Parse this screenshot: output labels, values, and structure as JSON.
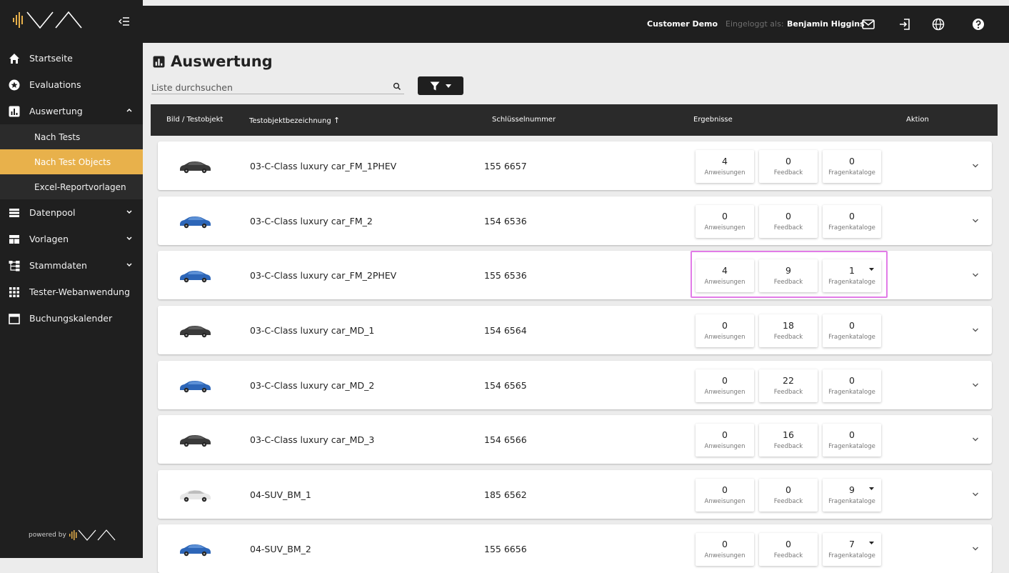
{
  "sidebar": {
    "items": [
      {
        "label": "Startseite",
        "icon": "home-icon"
      },
      {
        "label": "Evaluations",
        "icon": "star-badge-icon"
      },
      {
        "label": "Auswertung",
        "icon": "chart-icon"
      }
    ],
    "subitems": [
      {
        "label": "Nach Tests"
      },
      {
        "label": "Nach Test Objects"
      },
      {
        "label": "Excel-Reportvorlagen"
      }
    ],
    "items2": [
      {
        "label": "Datenpool",
        "icon": "list-icon"
      },
      {
        "label": "Vorlagen",
        "icon": "template-icon"
      },
      {
        "label": "Stammdaten",
        "icon": "hierarchy-icon"
      },
      {
        "label": "Tester-Webanwendung",
        "icon": "grid-icon"
      },
      {
        "label": "Buchungskalender",
        "icon": "calendar-icon"
      }
    ],
    "powered_by": "powered by"
  },
  "topbar": {
    "customer": "Customer Demo",
    "logged_in_label": "Eingeloggt als:",
    "user_name": "Benjamin Higgins"
  },
  "main": {
    "title": "Auswertung",
    "search_placeholder": "Liste durchsuchen",
    "columns": {
      "image": "Bild / Testobjekt",
      "name": "Testobjektbezeichnung",
      "sort_indicator": "↑",
      "key": "Schlüsselnummer",
      "results": "Ergebnisse",
      "action": "Aktion"
    },
    "card_labels": {
      "instructions": "Anweisungen",
      "feedback": "Feedback",
      "catalogs": "Fragenkataloge"
    },
    "rows": [
      {
        "name": "03-C-Class luxury car_FM_1PHEV",
        "key": "155 6657",
        "a": "4",
        "f": "0",
        "q": "0",
        "car": "dark"
      },
      {
        "name": "03-C-Class luxury car_FM_2",
        "key": "154 6536",
        "a": "0",
        "f": "0",
        "q": "0",
        "car": "blue"
      },
      {
        "name": "03-C-Class luxury car_FM_2PHEV",
        "key": "155 6536",
        "a": "4",
        "f": "9",
        "q": "1",
        "car": "blue"
      },
      {
        "name": "03-C-Class luxury car_MD_1",
        "key": "154 6564",
        "a": "0",
        "f": "18",
        "q": "0",
        "car": "dark"
      },
      {
        "name": "03-C-Class luxury car_MD_2",
        "key": "154 6565",
        "a": "0",
        "f": "22",
        "q": "0",
        "car": "blue"
      },
      {
        "name": "03-C-Class luxury car_MD_3",
        "key": "154 6566",
        "a": "0",
        "f": "16",
        "q": "0",
        "car": "dark"
      },
      {
        "name": "04-SUV_BM_1",
        "key": "185 6562",
        "a": "0",
        "f": "0",
        "q": "9",
        "car": "white"
      },
      {
        "name": "04-SUV_BM_2",
        "key": "155 6656",
        "a": "0",
        "f": "0",
        "q": "7",
        "car": "blue"
      }
    ]
  },
  "colors": {
    "sidebar": "#1f1f1f",
    "accent": "#e8b14b",
    "highlight": "#e17be7"
  }
}
